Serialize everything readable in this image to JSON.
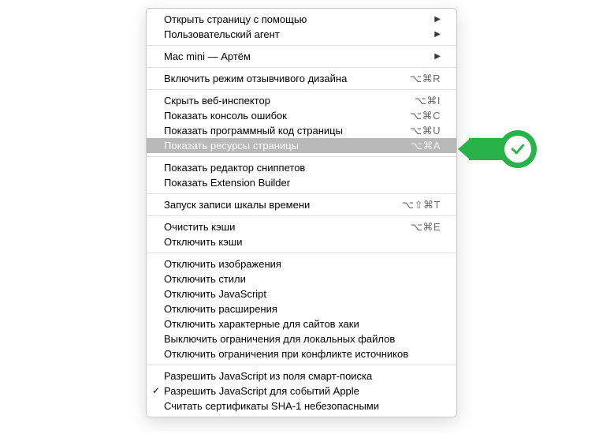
{
  "menu": {
    "groups": [
      [
        {
          "label": "Открыть страницу с помощью",
          "submenu": true
        },
        {
          "label": "Пользовательский агент",
          "submenu": true
        }
      ],
      [
        {
          "label": "Mac mini — Артём",
          "submenu": true
        }
      ],
      [
        {
          "label": "Включить режим отзывчивого дизайна",
          "shortcut": "⌥⌘R"
        }
      ],
      [
        {
          "label": "Скрыть веб-инспектор",
          "shortcut": "⌥⌘I"
        },
        {
          "label": "Показать консоль ошибок",
          "shortcut": "⌥⌘C"
        },
        {
          "label": "Показать программный код страницы",
          "shortcut": "⌥⌘U"
        },
        {
          "label": "Показать ресурсы страницы",
          "shortcut": "⌥⌘A",
          "highlight": true
        }
      ],
      [
        {
          "label": "Показать редактор сниппетов"
        },
        {
          "label": "Показать Extension Builder"
        }
      ],
      [
        {
          "label": "Запуск записи шкалы времени",
          "shortcut": "⌥⇧⌘T"
        }
      ],
      [
        {
          "label": "Очистить кэши",
          "shortcut": "⌥⌘E"
        },
        {
          "label": "Отключить кэши"
        }
      ],
      [
        {
          "label": "Отключить изображения"
        },
        {
          "label": "Отключить стили"
        },
        {
          "label": "Отключить JavaScript"
        },
        {
          "label": "Отключить расширения"
        },
        {
          "label": "Отключить характерные для сайтов хаки"
        },
        {
          "label": "Выключить ограничения для локальных файлов"
        },
        {
          "label": "Отключить ограничения при конфликте источников"
        }
      ],
      [
        {
          "label": "Разрешить JavaScript из поля смарт-поиска"
        },
        {
          "label": "Разрешить JavaScript для событий Apple",
          "checked": true
        },
        {
          "label": "Считать сертификаты SHA-1 небезопасными"
        }
      ]
    ]
  }
}
